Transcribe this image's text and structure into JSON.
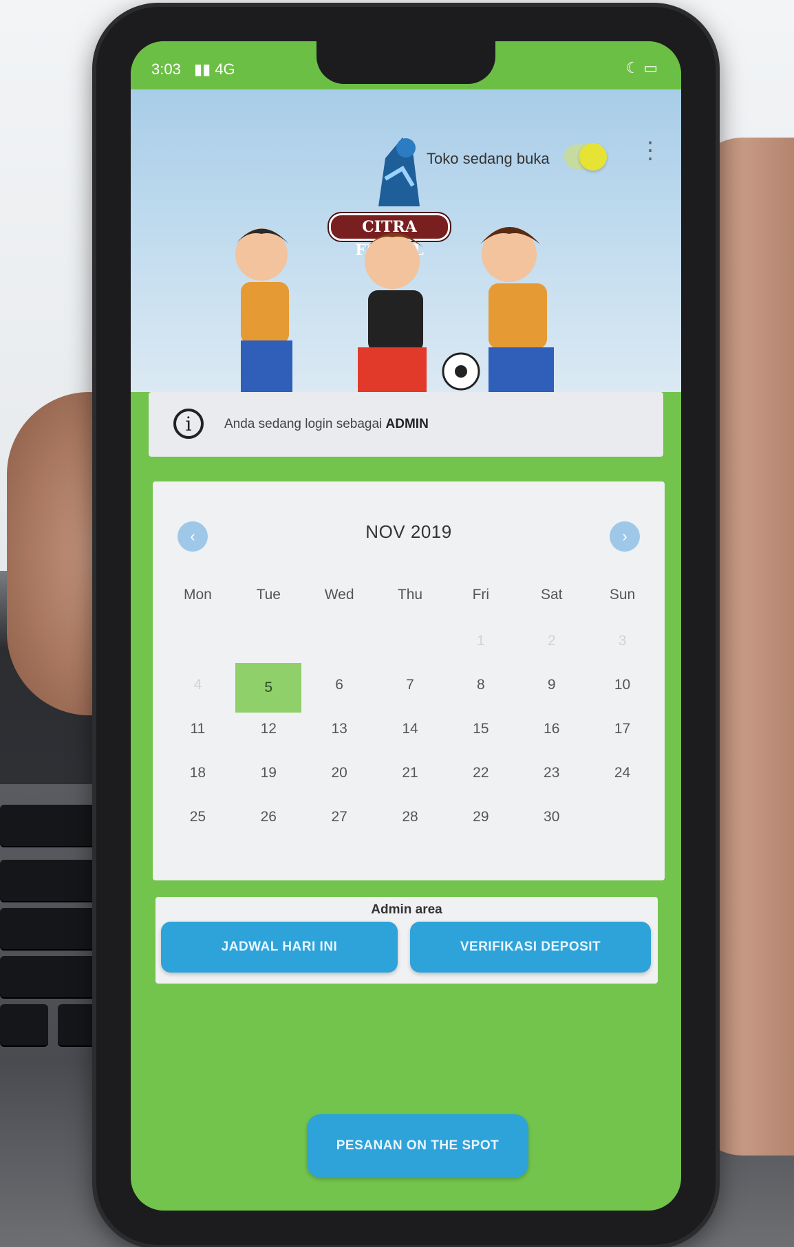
{
  "status_bar": {
    "time": "3:03",
    "signal": "▮▮ 4G",
    "battery": "☾ ▭"
  },
  "header": {
    "logo_text": "CITRA FUTSAL",
    "store_status_label": "Toko sedang buka",
    "store_open": true
  },
  "info": {
    "message": "Anda sedang login sebagai",
    "role": "ADMIN"
  },
  "calendar": {
    "month_label": "NOV 2019",
    "weekdays": [
      "Mon",
      "Tue",
      "Wed",
      "Thu",
      "Fri",
      "Sat",
      "Sun"
    ],
    "selected_day": "5",
    "prev_label": "‹",
    "next_label": "›"
  },
  "admin_area": {
    "title": "Admin area",
    "jadwal_label": "JADWAL HARI INI",
    "verifikasi_label": "VERIFIKASI DEPOSIT"
  },
  "bottom": {
    "spot_label": "PESANAN ON THE SPOT"
  },
  "colors": {
    "app_green": "#72c44c",
    "button_blue": "#2ea3d9",
    "selected_day": "#8fd06a"
  }
}
